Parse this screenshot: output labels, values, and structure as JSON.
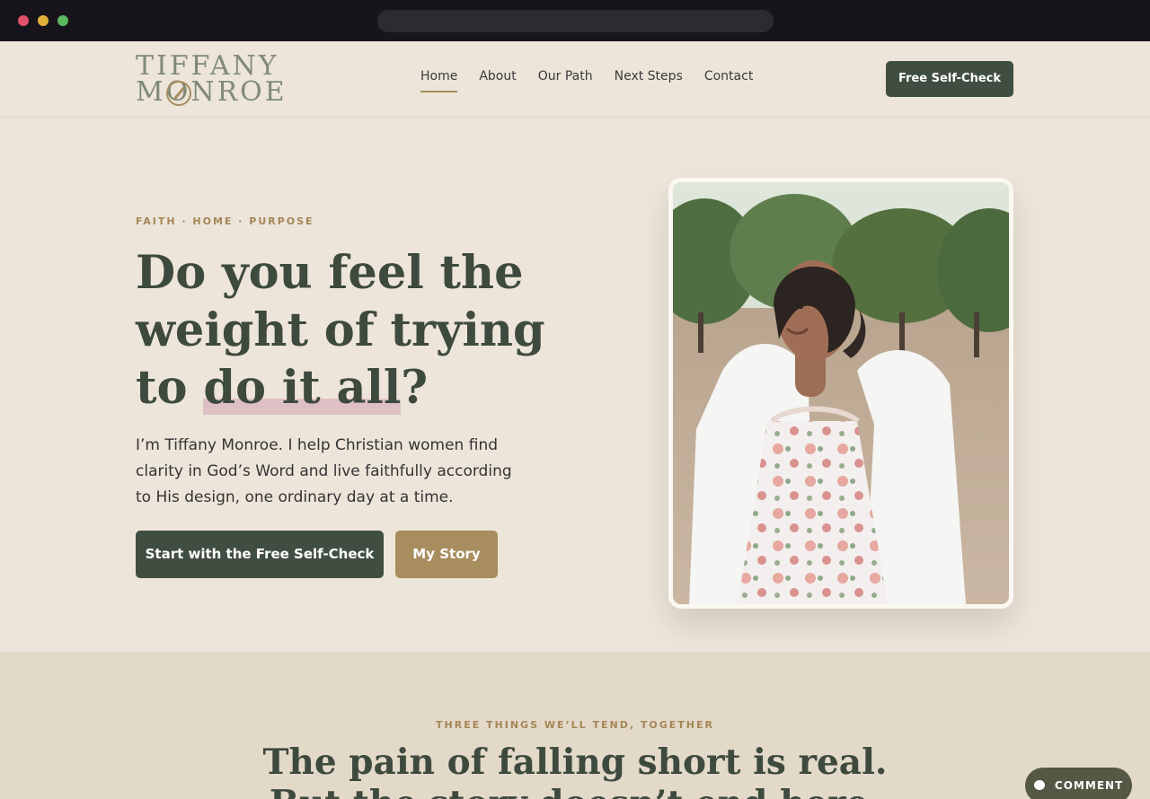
{
  "logo": {
    "line1": "TIFFANY",
    "line2": "MONROE"
  },
  "nav": {
    "items": [
      {
        "label": "Home",
        "active": true
      },
      {
        "label": "About"
      },
      {
        "label": "Our Path"
      },
      {
        "label": "Next Steps"
      },
      {
        "label": "Contact"
      }
    ],
    "cta_label": "Free Self-Check"
  },
  "hero": {
    "eyebrow": "FAITH · HOME · PURPOSE",
    "headline": {
      "line1": "Do you feel the",
      "line2": "weight of trying",
      "line3_prefix": "to ",
      "line3_highlight": "do it all",
      "line3_suffix": "?"
    },
    "intro": "I’m Tiffany Monroe. I help Christian women find clarity in God’s Word and live faithfully according to His design, one ordinary day at a time.",
    "primary_label": "Start with the Free Self-Check",
    "secondary_label": "My Story"
  },
  "section": {
    "eyebrow": "THREE THINGS WE’LL TEND, TOGETHER",
    "title": "The pain of falling short is real.",
    "title_line2": "But the story doesn’t end here."
  },
  "comment_label": "COMMENT",
  "colors": {
    "background": "#ede5d9",
    "primary": "#404e41",
    "accent": "#a88d5f",
    "highlight": "#dec0c4"
  },
  "icons": {
    "compass": "compass-icon",
    "comment": "comment-icon"
  }
}
